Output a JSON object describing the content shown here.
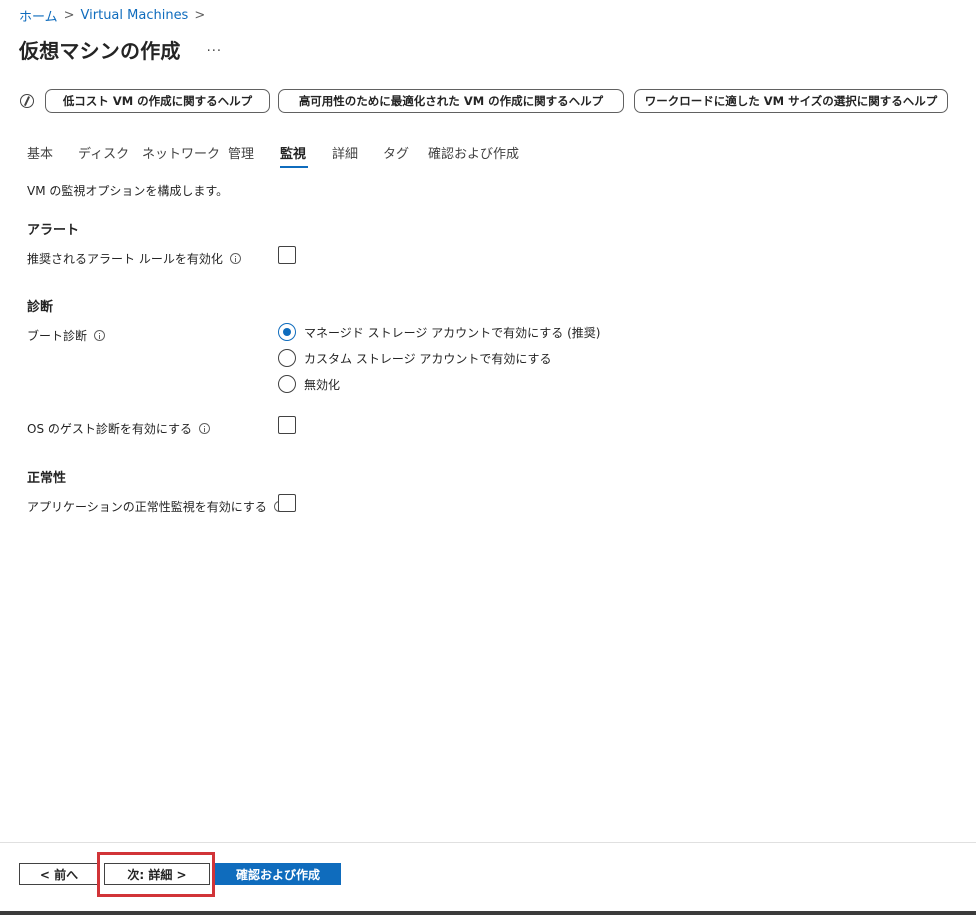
{
  "breadcrumb": {
    "items": [
      "ホーム",
      "Virtual Machines"
    ],
    "separator": ">"
  },
  "title": {
    "text": "仮想マシンの作成",
    "more": "···"
  },
  "help_buttons": [
    "低コスト VM の作成に関するヘルプ",
    "高可用性のために最適化された VM の作成に関するヘルプ",
    "ワークロードに適した VM サイズの選択に関するヘルプ"
  ],
  "tabs": [
    {
      "label": "基本",
      "active": false
    },
    {
      "label": "ディスク",
      "active": false
    },
    {
      "label": "ネットワーク",
      "active": false
    },
    {
      "label": "管理",
      "active": false
    },
    {
      "label": "監視",
      "active": true
    },
    {
      "label": "詳細",
      "active": false
    },
    {
      "label": "タグ",
      "active": false
    },
    {
      "label": "確認および作成",
      "active": false
    }
  ],
  "description": "VM の監視オプションを構成します。",
  "sections": {
    "alerts": {
      "title": "アラート",
      "recommended_rules_label": "推奨されるアラート ルールを有効化",
      "recommended_rules_checked": false
    },
    "diagnostics": {
      "title": "診断",
      "boot_label": "ブート診断",
      "boot_options": [
        "マネージド ストレージ アカウントで有効にする (推奨)",
        "カスタム ストレージ アカウントで有効にする",
        "無効化"
      ],
      "boot_selected": 0,
      "guest_os_label": "OS のゲスト診断を有効にする",
      "guest_os_checked": false
    },
    "health": {
      "title": "正常性",
      "app_health_label": "アプリケーションの正常性監視を有効にする",
      "app_health_checked": false
    }
  },
  "footer": {
    "prev_label": "< 前へ",
    "next_label": "次: 詳細 >",
    "review_label": "確認および作成"
  },
  "colors": {
    "accent": "#0f6cbd",
    "highlight": "#d13438"
  }
}
